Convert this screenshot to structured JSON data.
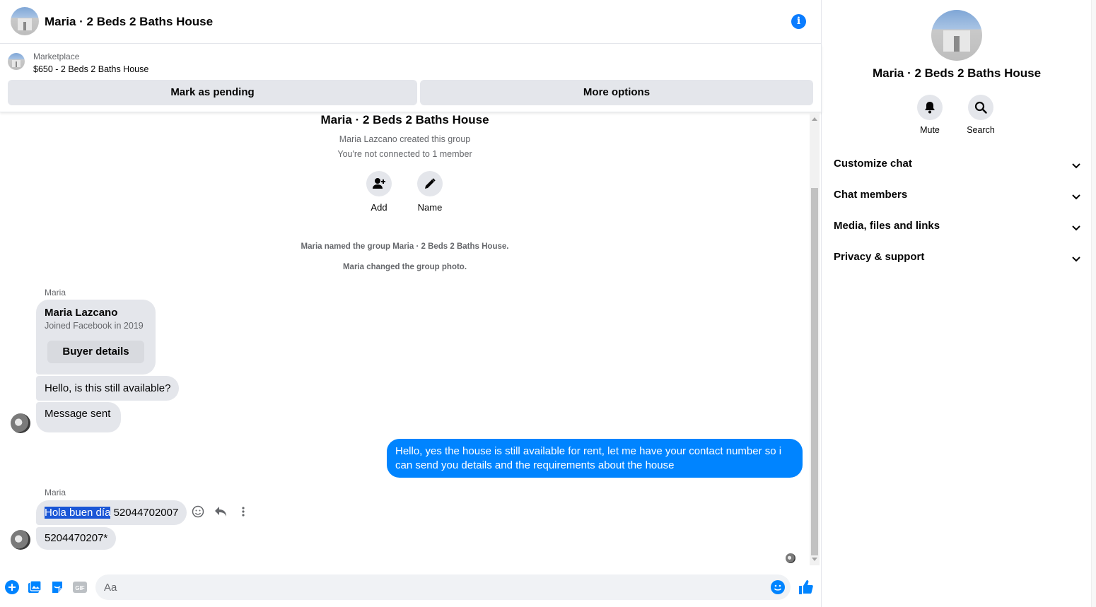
{
  "header": {
    "title": "Maria · 2 Beds 2 Baths House",
    "info_icon": "info-icon"
  },
  "marketplace": {
    "label": "Marketplace",
    "item": "$650 - 2 Beds 2 Baths House",
    "pending_button": "Mark as pending",
    "more_button": "More options"
  },
  "intro": {
    "title": "Maria · 2 Beds 2 Baths House",
    "created": "Maria Lazcano created this group",
    "connected": "You're not connected to 1 member",
    "add_label": "Add",
    "name_label": "Name",
    "system_1": "Maria named the group Maria · 2 Beds 2 Baths House.",
    "system_2": "Maria changed the group photo."
  },
  "messages": {
    "sender_1": "Maria",
    "card_name": "Maria Lazcano",
    "card_joined": "Joined Facebook in 2019",
    "card_button": "Buyer details",
    "msg_available": "Hello, is this still available?",
    "msg_sent": "Message sent",
    "my_reply": "Hello, yes the house is still available for rent, let me have your contact number so i can send you details and the requirements about the house",
    "sender_2": "Maria",
    "msg_hola_selected": "Hola buen día",
    "msg_hola_rest": " 52044702007",
    "msg_correction": "5204470207*"
  },
  "composer": {
    "placeholder": "Aa"
  },
  "side_panel": {
    "title": "Maria · 2 Beds 2 Baths House",
    "mute_label": "Mute",
    "search_label": "Search",
    "sections": [
      "Customize chat",
      "Chat members",
      "Media, files and links",
      "Privacy & support"
    ]
  },
  "colors": {
    "accent": "#0084ff",
    "bubble_gray": "#e4e6eb",
    "selection": "#1a56d6"
  }
}
